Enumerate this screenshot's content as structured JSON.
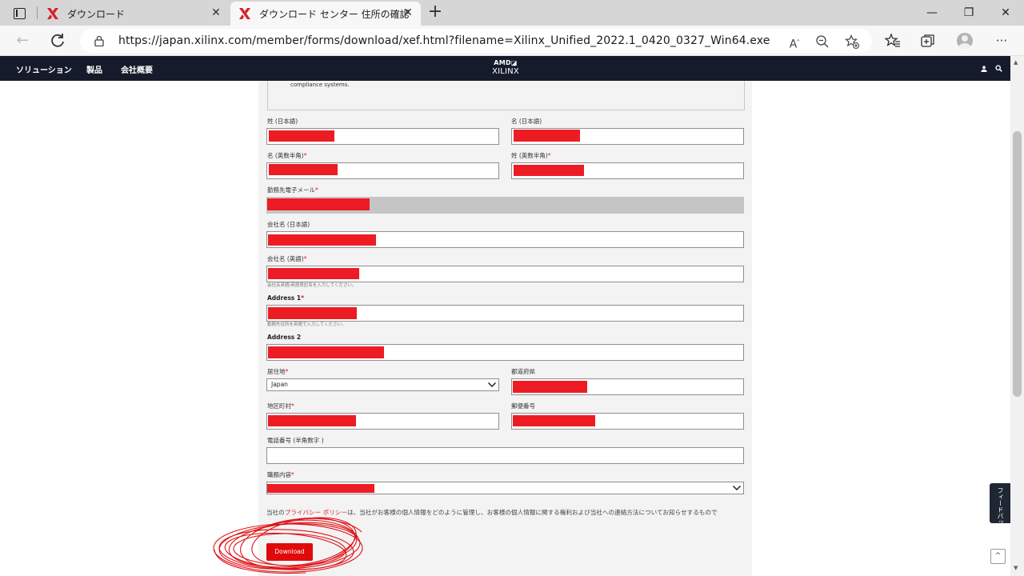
{
  "browser": {
    "tabs": [
      {
        "title": "ダウンロード",
        "active": false
      },
      {
        "title": "ダウンロード センター 住所の確認",
        "active": true
      }
    ],
    "new_tab_label": "+",
    "window_controls": {
      "minimize": "—",
      "restore": "❐",
      "close": "✕"
    },
    "url": "https://japan.xilinx.com/member/forms/download/xef.html?filename=Xilinx_Unified_2022.1_0420_0327_Win64.exe",
    "read_aloud_label": "A"
  },
  "site_header": {
    "nav_items": [
      "ソリューション",
      "製品",
      "会社概要"
    ],
    "logo_top": "AMD",
    "logo_bottom": "XILINX"
  },
  "form": {
    "info_text": "compliance systems.",
    "fields": {
      "last_name_ja": {
        "label": "姓 (日本語)"
      },
      "first_name_ja": {
        "label": "名 (日本語)"
      },
      "first_name_en": {
        "label": "名 (英数半角)",
        "required": "*"
      },
      "last_name_en": {
        "label": "姓 (英数半角)",
        "required": "*"
      },
      "email": {
        "label": "勤務先電子メール",
        "required": "*"
      },
      "company_ja": {
        "label": "会社名 (日本語)"
      },
      "company_en": {
        "label": "会社名 (英語)",
        "required": "*",
        "hint": "会社名英語/英語表記名を入力してください。"
      },
      "address1": {
        "label": "Address 1",
        "required": "*",
        "hint": "勤務先住所を英語で入力してください。"
      },
      "address2": {
        "label": "Address 2"
      },
      "country": {
        "label": "居住地",
        "required": "*",
        "value": "Japan"
      },
      "prefecture": {
        "label": "都道府県"
      },
      "city": {
        "label": "地区町村",
        "required": "*"
      },
      "postal": {
        "label": "郵便番号"
      },
      "phone": {
        "label": "電話番号 (半角数字 )"
      },
      "job_role": {
        "label": "職務内容",
        "required": "*"
      }
    },
    "privacy_prefix": "当社の",
    "privacy_link": "プライバシー ポリシー",
    "privacy_suffix": "は、当社がお客様の個人情報をどのように管理し、お客様の個人情報に関する権利および当社への連絡方法についてお知らせするもので",
    "download_label": "Download"
  },
  "feedback_label": "フィードバック",
  "back_to_top_label": "^",
  "colors": {
    "site_header": "#151b2a",
    "accent_red": "#e00a0a",
    "redaction": "#ed1c24",
    "form_bg": "#f3f3f3"
  }
}
